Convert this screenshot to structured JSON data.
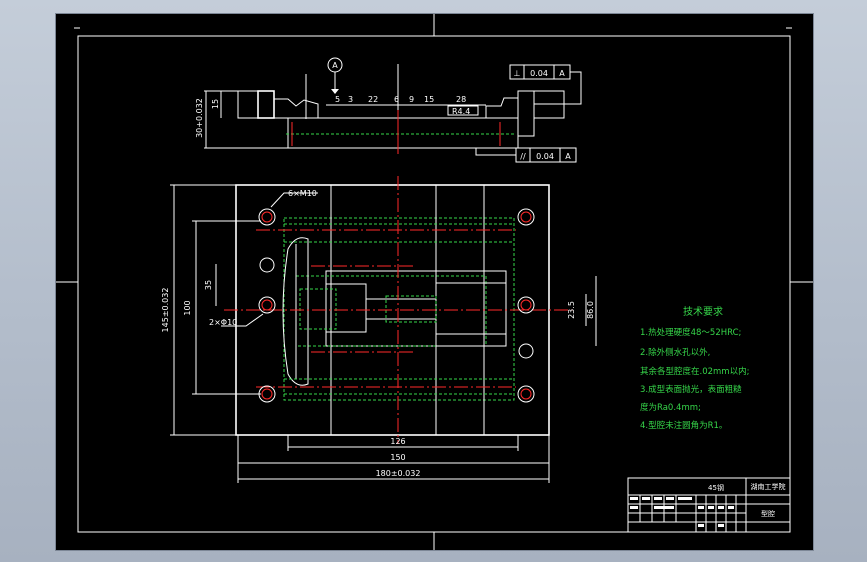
{
  "section_view": {
    "datum_label": "A",
    "dims_top": [
      "5",
      "3",
      "22",
      "6",
      "9",
      "15",
      "28"
    ],
    "dim_r": "R4.4",
    "dim_left_small": "15",
    "dim_left_rot": "30+0.032"
  },
  "tolerances": {
    "perp_symbol": "⊥",
    "perp_value": "0.04",
    "perp_datum": "A",
    "par_symbol": "//",
    "par_value": "0.04",
    "par_datum": "A"
  },
  "plan_view": {
    "dim_holes": "6×M10",
    "dim_pins": "2×Φ10",
    "dim_145": "145±0.032",
    "dim_100": "100",
    "dim_35": "35",
    "dim_23_5": "23.5",
    "dim_86": "86.0",
    "dim_126": "126",
    "dim_150": "150",
    "dim_180": "180±0.032"
  },
  "tech_requirements": {
    "title": "技术要求",
    "items": [
      "1.热处理硬度48～52HRC;",
      "2.除外侧水孔以外,",
      "其余各型腔度在.02mm以内;",
      "3.成型表面抛光，表面粗糙",
      "度为Ra0.4mm;",
      "4.型腔未注圆角为R1。"
    ]
  },
  "title_block": {
    "material": "45钢",
    "school": "湖南工学院",
    "part_name": "型腔"
  }
}
